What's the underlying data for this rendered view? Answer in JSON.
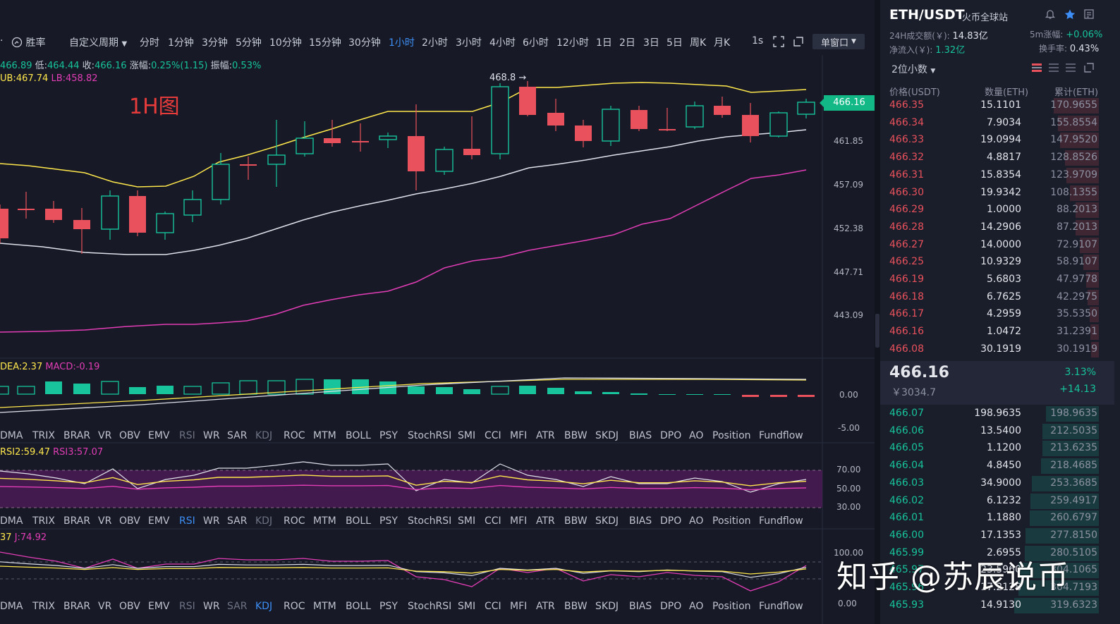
{
  "toolbar": {
    "winrate": "胜率",
    "custom_period": "自定义周期",
    "periods": [
      "分时",
      "1分钟",
      "3分钟",
      "5分钟",
      "10分钟",
      "15分钟",
      "30分钟",
      "1小时",
      "2小时",
      "3小时",
      "4小时",
      "6小时",
      "12小时",
      "1日",
      "2日",
      "3日",
      "5日",
      "周K",
      "月K"
    ],
    "active_period": "1小时",
    "speed": "1s",
    "window_mode": "单窗口"
  },
  "ohlc": {
    "high_partial": "466.89",
    "low_label": "低:",
    "low": "464.44",
    "close_label": "收:",
    "close": "466.16",
    "change_label": "涨幅:",
    "change": "0.25%(1.15)",
    "amp_label": "振幅:",
    "amp": "0.53%"
  },
  "boll": {
    "ub": "UB:467.74",
    "lb": "LB:458.82"
  },
  "chart_title": "1H图",
  "peak_label": "468.8 →",
  "price_axis": [
    "461.85",
    "457.09",
    "452.38",
    "447.71",
    "443.09"
  ],
  "current_price": "466.16",
  "macd": {
    "dea": "DEA:2.37",
    "macd": "MACD:-0.19",
    "axis": [
      "0.00",
      "-5.00"
    ]
  },
  "rsi": {
    "rsi2": "RSI2:59.47",
    "rsi3": "RSI3:57.07",
    "axis": [
      "70.00",
      "50.00",
      "30.00"
    ]
  },
  "kdj": {
    "partial": "37",
    "j": "J:74.92",
    "axis": [
      "100.00",
      "0.00"
    ]
  },
  "indicators": [
    "DMA",
    "TRIX",
    "BRAR",
    "VR",
    "OBV",
    "EMV",
    "RSI",
    "WR",
    "SAR",
    "KDJ",
    "ROC",
    "MTM",
    "BOLL",
    "PSY",
    "StochRSI",
    "SMI",
    "CCI",
    "MFI",
    "ATR",
    "BBW",
    "SKDJ",
    "BIAS",
    "DPO",
    "AO",
    "Position",
    "Fundflow"
  ],
  "colors": {
    "up": "#17c49c",
    "down": "#e9525c",
    "accent": "#3d8ff7",
    "ub": "#ffe74c",
    "mb": "#dfe2ea",
    "lb": "#e23db6"
  },
  "panel": {
    "pair": "ETH/USDT",
    "exchange": "火币全球站",
    "vol_label": "24H成交额(￥):",
    "vol": "14.83亿",
    "change5_label": "5m涨幅:",
    "change5": "+0.06%",
    "inflow_label": "净流入(￥):",
    "inflow": "1.32亿",
    "turnover_label": "换手率:",
    "turnover": "0.43%",
    "decimals": "2位小数",
    "col_price": "价格(USDT)",
    "col_qty": "数量(ETH)",
    "col_cum": "累计(ETH)",
    "asks": [
      {
        "p": "466.35",
        "q": "15.1101",
        "c": "170.9655"
      },
      {
        "p": "466.34",
        "q": "7.9034",
        "c": "155.8554"
      },
      {
        "p": "466.33",
        "q": "19.0994",
        "c": "147.9520"
      },
      {
        "p": "466.32",
        "q": "4.8817",
        "c": "128.8526"
      },
      {
        "p": "466.31",
        "q": "15.8354",
        "c": "123.9709"
      },
      {
        "p": "466.30",
        "q": "19.9342",
        "c": "108.1355"
      },
      {
        "p": "466.29",
        "q": "1.0000",
        "c": "88.2013"
      },
      {
        "p": "466.28",
        "q": "14.2906",
        "c": "87.2013"
      },
      {
        "p": "466.27",
        "q": "14.0000",
        "c": "72.9107"
      },
      {
        "p": "466.25",
        "q": "10.9329",
        "c": "58.9107"
      },
      {
        "p": "466.19",
        "q": "5.6803",
        "c": "47.9778"
      },
      {
        "p": "466.18",
        "q": "6.7625",
        "c": "42.2975"
      },
      {
        "p": "466.17",
        "q": "4.2959",
        "c": "35.5350"
      },
      {
        "p": "466.16",
        "q": "1.0472",
        "c": "31.2391"
      },
      {
        "p": "466.08",
        "q": "30.1919",
        "c": "30.1919"
      }
    ],
    "mid_price": "466.16",
    "mid_cny": "￥3034.7",
    "mid_pct": "3.13%",
    "mid_chg": "+14.13",
    "bids": [
      {
        "p": "466.07",
        "q": "198.9635",
        "c": "198.9635"
      },
      {
        "p": "466.06",
        "q": "13.5400",
        "c": "212.5035"
      },
      {
        "p": "466.05",
        "q": "1.1200",
        "c": "213.6235"
      },
      {
        "p": "466.04",
        "q": "4.8450",
        "c": "218.4685"
      },
      {
        "p": "466.03",
        "q": "34.9000",
        "c": "253.3685"
      },
      {
        "p": "466.02",
        "q": "6.1232",
        "c": "259.4917"
      },
      {
        "p": "466.01",
        "q": "1.1880",
        "c": "260.6797"
      },
      {
        "p": "466.00",
        "q": "17.1353",
        "c": "277.8150"
      },
      {
        "p": "465.99",
        "q": "2.6955",
        "c": "280.5105"
      },
      {
        "p": "465.97",
        "q": "23.5960",
        "c": "304.1065"
      },
      {
        "p": "465.96",
        "q": "17.2128",
        "c": "304.7193"
      },
      {
        "p": "465.93",
        "q": "14.9130",
        "c": "319.6323"
      }
    ]
  },
  "watermark": "知乎 @苏辰说币"
}
